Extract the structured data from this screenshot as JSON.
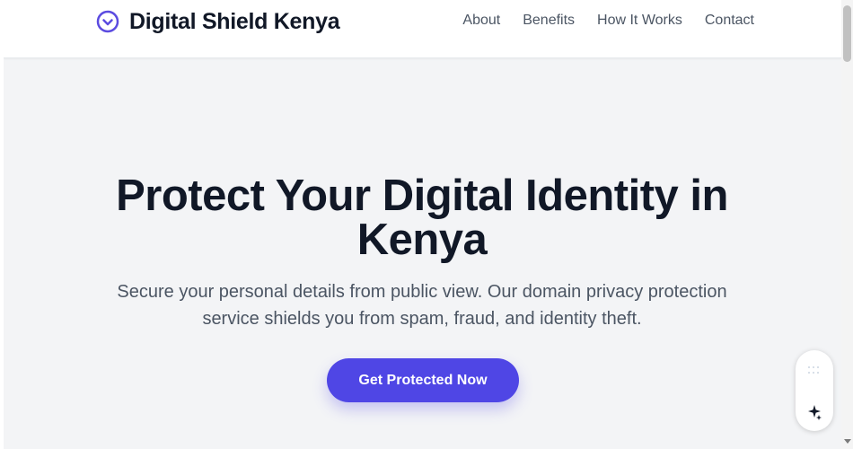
{
  "header": {
    "brand_name": "Digital Shield Kenya",
    "brand_icon": "shield-check-icon",
    "nav": [
      {
        "label": "About"
      },
      {
        "label": "Benefits"
      },
      {
        "label": "How It Works"
      },
      {
        "label": "Contact"
      }
    ]
  },
  "hero": {
    "title": "Protect Your Digital Identity in Kenya",
    "subtitle": "Secure your personal details from public view. Our domain privacy protection service shields you from spam, fraud, and identity theft.",
    "cta_label": "Get Protected Now"
  },
  "floating_widget": {
    "icons": [
      "drag-handle-icon",
      "sparkle-icon"
    ]
  },
  "colors": {
    "accent": "#4f46e5",
    "heading": "#111827",
    "body_text": "#4b5563",
    "hero_background": "#f3f4f6",
    "header_background": "#ffffff"
  }
}
